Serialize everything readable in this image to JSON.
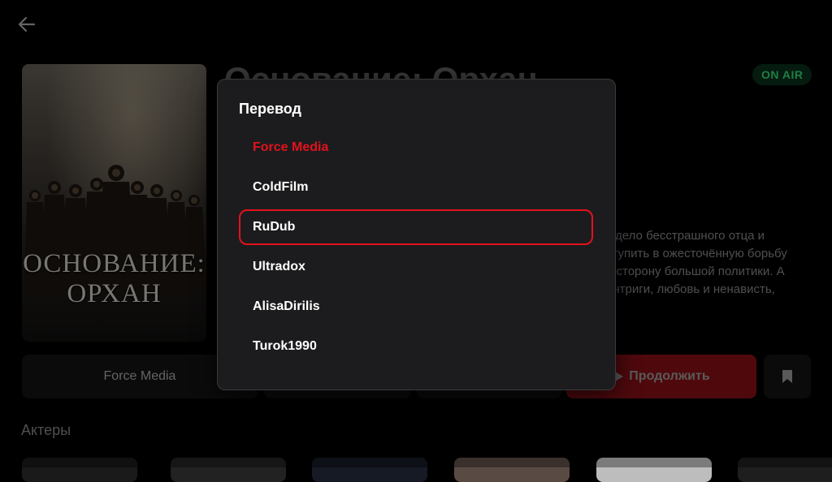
{
  "header": {
    "back_icon": "arrow-left-icon"
  },
  "show": {
    "poster_title_line1": "ОСНОВАНИЕ:",
    "poster_title_line2": "ОРХАН",
    "title": "Основание: Орхан",
    "status_badge": "ON AIR",
    "description_lines": [
      "т дело бесстрашного отца и",
      "ступить в ожесточённую борьбу",
      "о сторону большой политики. А",
      "интриги, любовь и ненависть,"
    ]
  },
  "actions": {
    "translation_label": "Force Media",
    "continue_label": "Продолжить",
    "continue_icon": "play-icon",
    "bookmark_icon": "bookmark-icon"
  },
  "actors": {
    "heading": "Актеры"
  },
  "translation_dialog": {
    "title": "Перевод",
    "options": [
      {
        "label": "Force Media",
        "state": "selected"
      },
      {
        "label": "ColdFilm",
        "state": "normal"
      },
      {
        "label": "RuDub",
        "state": "focused"
      },
      {
        "label": "Ultradox",
        "state": "normal"
      },
      {
        "label": "AlisaDirilis",
        "state": "normal"
      },
      {
        "label": "Turok1990",
        "state": "normal"
      }
    ]
  },
  "colors": {
    "accent": "#e3121c",
    "on_air_text": "#2ec26a",
    "background": "#000000",
    "dialog_bg": "#1c1c1e"
  }
}
